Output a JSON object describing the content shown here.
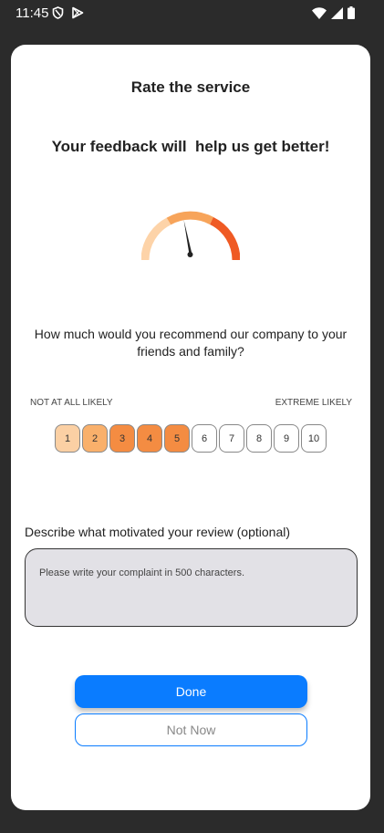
{
  "status_bar": {
    "time": "11:45",
    "left_icons": [
      "shield-icon",
      "play-store-icon"
    ],
    "right_icons": [
      "wifi-icon",
      "signal-icon",
      "battery-icon"
    ]
  },
  "card": {
    "title": "Rate the service",
    "subtitle": "Your feedback will  help us get better!",
    "gauge": {
      "icon": "gauge-icon",
      "colors": [
        "#fdd3a8",
        "#f7a45a",
        "#ef5a24"
      ]
    },
    "question": "How much would you recommend our company to your friends and family?",
    "scale": {
      "low_label": "NOT AT ALL LIKELY",
      "high_label": "EXTREME LIKELY",
      "options": [
        {
          "label": "1",
          "color": "#fbd0a4"
        },
        {
          "label": "2",
          "color": "#f9b06b"
        },
        {
          "label": "3",
          "color": "#f48c42"
        },
        {
          "label": "4",
          "color": "#f48c42"
        },
        {
          "label": "5",
          "color": "#f48c42"
        },
        {
          "label": "6",
          "color": "#ffffff"
        },
        {
          "label": "7",
          "color": "#ffffff"
        },
        {
          "label": "8",
          "color": "#ffffff"
        },
        {
          "label": "9",
          "color": "#ffffff"
        },
        {
          "label": "10",
          "color": "#ffffff"
        }
      ]
    },
    "review": {
      "label": "Describe what motivated your review (optional)",
      "placeholder": "Please write your complaint in 500 characters.",
      "value": ""
    },
    "done_label": "Done",
    "not_now_label": "Not Now"
  },
  "colors": {
    "accent": "#0a7cff",
    "background": "#2b2b2b",
    "card": "#ffffff"
  }
}
